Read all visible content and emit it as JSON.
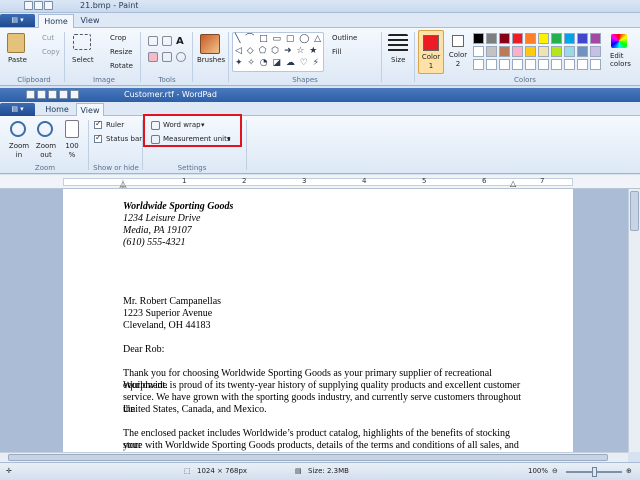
{
  "paint": {
    "title": "21.bmp - Paint",
    "tabs": [
      "Home",
      "View"
    ],
    "clipboard": {
      "paste": "Paste",
      "cut": "Cut",
      "copy": "Copy",
      "group": "Clipboard"
    },
    "image": {
      "select": "Select",
      "crop": "Crop",
      "resize": "Resize",
      "rotate": "Rotate",
      "group": "Image"
    },
    "tools": {
      "group": "Tools"
    },
    "brushes": "Brushes",
    "shapes": {
      "outline": "Outline",
      "fill": "Fill",
      "group": "Shapes"
    },
    "size": "Size",
    "color1": "Color 1",
    "color2": "Color 2",
    "colors_group": "Colors",
    "edit_colors": "Edit colors",
    "palette": [
      "#000000",
      "#7f7f7f",
      "#880015",
      "#ed1c24",
      "#ff7f27",
      "#fff200",
      "#22b14c",
      "#00a2e8",
      "#3f48cc",
      "#a349a4",
      "#ffffff",
      "#c3c3c3",
      "#b97a57",
      "#ffaec9",
      "#ffc90e",
      "#efe4b0",
      "#b5e61d",
      "#99d9ea",
      "#7092be",
      "#c8bfe7"
    ]
  },
  "wordpad": {
    "title": "Customer.rtf - WordPad",
    "tabs": [
      "Home",
      "View"
    ],
    "zoom_in": "Zoom in",
    "zoom_out": "Zoom out",
    "zoom_100": "100 %",
    "zoom_group": "Zoom",
    "ruler": "Ruler",
    "status_bar": "Status bar",
    "show_hide_group": "Show or hide",
    "word_wrap": "Word wrap",
    "measurement_units": "Measurement units",
    "settings_group": "Settings",
    "ruler_numbers": [
      "1",
      "2",
      "3",
      "4",
      "5",
      "6",
      "7"
    ]
  },
  "document": {
    "company": "Worldwide Sporting Goods",
    "addr1": "1234 Leisure Drive",
    "addr2": "Media, PA 19107",
    "phone": "(610) 555-4321",
    "to_name": "Mr. Robert Campanellas",
    "to_addr1": "1223 Superior Avenue",
    "to_addr2": "Cleveland, OH  44183",
    "salutation": "Dear Rob:",
    "p1": [
      "Thank you for choosing Worldwide Sporting Goods as your primary supplier of recreational equipment.",
      "Worldwide is proud of its twenty-year history of supplying quality products and excellent customer",
      "service. We have grown with the sporting goods industry, and currently serve customers throughout the",
      "United States, Canada, and Mexico."
    ],
    "p2": [
      "The enclosed packet includes Worldwide’s product catalog, highlights of the benefits of stocking your",
      "store with Worldwide Sporting Goods products, details of the terms and conditions of all sales, and our"
    ]
  },
  "status": {
    "dimensions": "1024 × 768px",
    "size": "Size: 2.3MB",
    "zoom": "100%"
  },
  "colors": {
    "accent_red": "#e0141e",
    "title_blue": "#2d5fa8"
  }
}
